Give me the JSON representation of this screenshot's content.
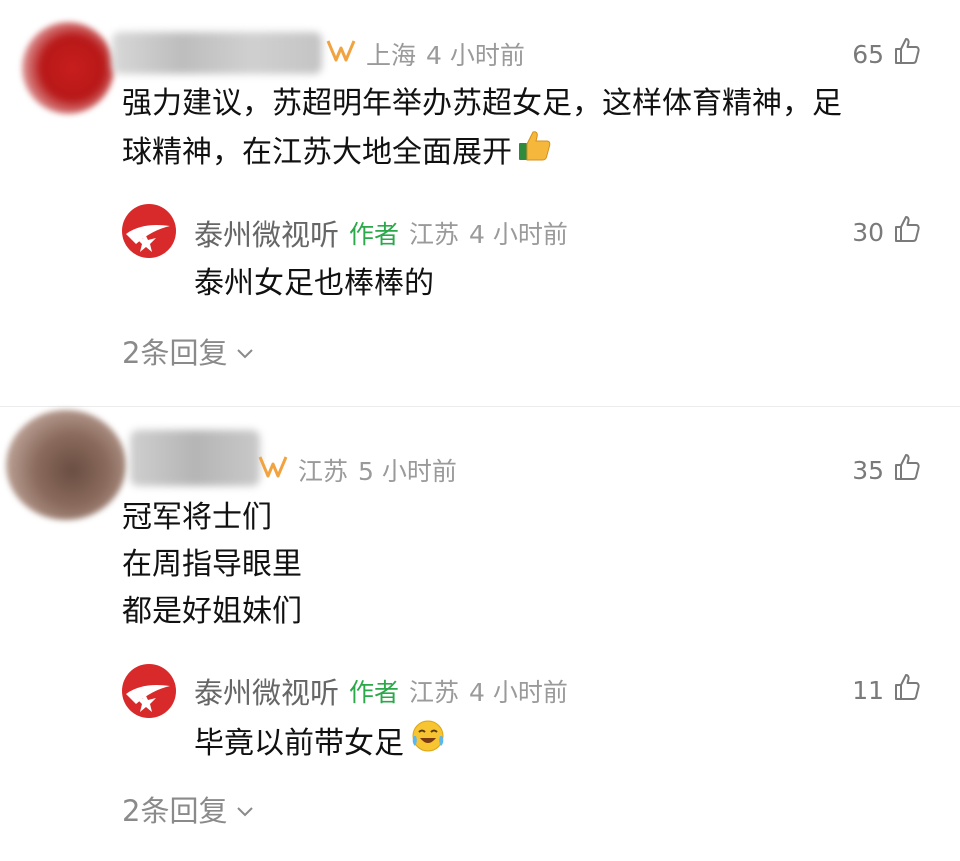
{
  "comments": [
    {
      "location": "上海",
      "time": "4 小时前",
      "likes": "65",
      "text_lines": [
        "强力建议，苏超明年举办苏超女足，这样体育精神，足",
        "球精神，在江苏大地全面展开"
      ],
      "emoji_icon": "thumbs-up-emoji",
      "reply": {
        "name": "泰州微视听",
        "author_tag": "作者",
        "location": "江苏",
        "time": "4 小时前",
        "likes": "30",
        "text": "泰州女足也棒棒的"
      },
      "replies_label": "2条回复"
    },
    {
      "location": "江苏",
      "time": "5 小时前",
      "likes": "35",
      "text_lines": [
        "冠军将士们",
        "在周指导眼里",
        "都是好姐妹们"
      ],
      "reply": {
        "name": "泰州微视听",
        "author_tag": "作者",
        "location": "江苏",
        "time": "4 小时前",
        "likes": "11",
        "text": "毕竟以前带女足",
        "emoji_icon": "laughing-crying-emoji"
      },
      "replies_label": "2条回复"
    }
  ],
  "colors": {
    "author_green": "#2aa84a",
    "meta_gray": "#9a9a9a",
    "weibo_red": "#d82a2a",
    "badge_orange": "#f2a341"
  }
}
